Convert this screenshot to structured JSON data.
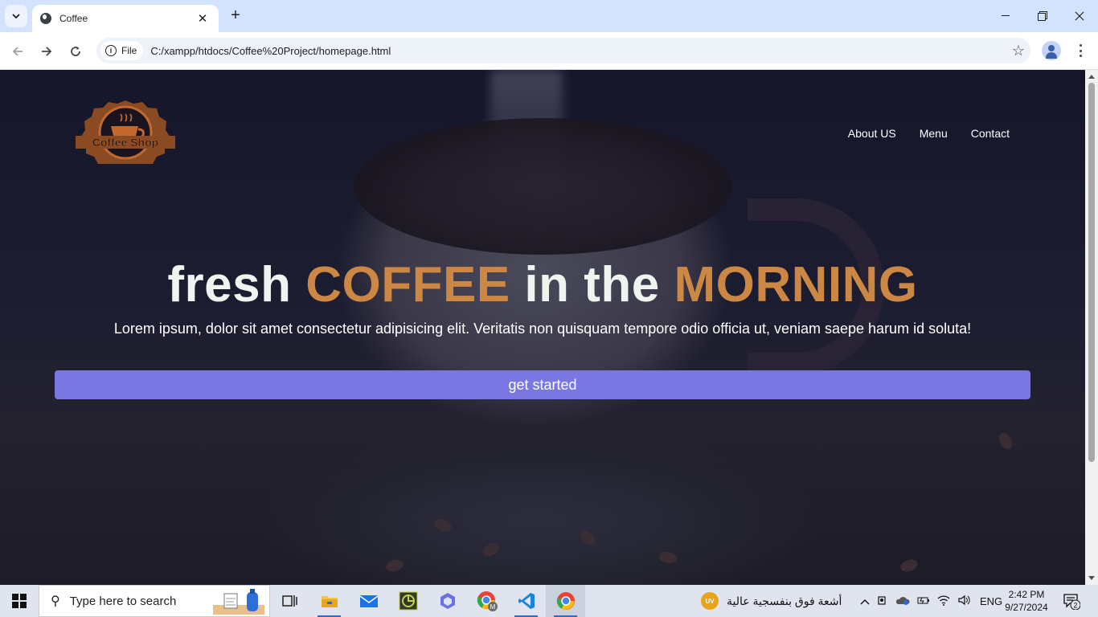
{
  "browser": {
    "tab_title": "Coffee",
    "tab_close": "✕",
    "new_tab": "+",
    "chip_label": "File",
    "url": "C:/xampp/htdocs/Coffee%20Project/homepage.html",
    "window_controls": {
      "minimize": "—",
      "maximize": "❐",
      "close": "✕"
    }
  },
  "page": {
    "logo_text": "Coffee Shop",
    "nav": [
      "About US",
      "Menu",
      "Contact"
    ],
    "hero_title": {
      "part1": "fresh",
      "accent1": "COFFEE",
      "part2": "in the",
      "accent2": "MORNING"
    },
    "hero_text": "Lorem ipsum, dolor sit amet consectetur adipisicing elit. Veritatis non quisquam tempore odio officia ut, veniam saepe harum id soluta!",
    "cta_label": "get started",
    "colors": {
      "accent": "#cb8743",
      "button": "#7b77e2",
      "title": "#eef5ef"
    }
  },
  "taskbar": {
    "search_placeholder": "Type here to search",
    "weather_badge": "UV",
    "weather_text": "أشعة فوق بنفسجية عالية",
    "language": "ENG",
    "time": "2:42 PM",
    "date": "9/27/2024",
    "notification_count": "2",
    "apps": [
      "task-view-icon",
      "file-explorer-icon",
      "mail-icon",
      "app-icon",
      "copilot-icon",
      "chrome-profile-icon",
      "vscode-icon",
      "chrome-icon"
    ]
  }
}
